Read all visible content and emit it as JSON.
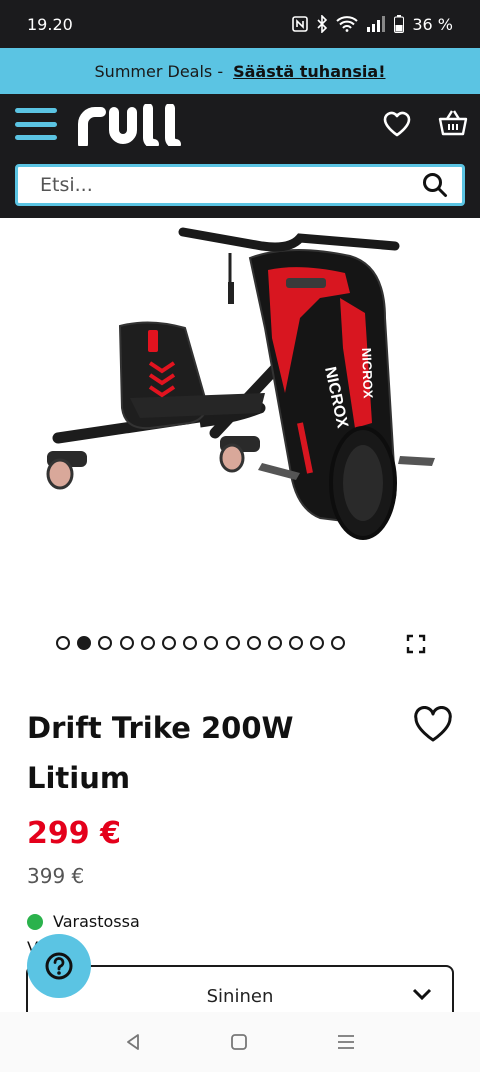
{
  "status_bar": {
    "time": "19.20",
    "battery": "36 %",
    "icons": [
      "nfc-icon",
      "bluetooth-icon",
      "wifi-icon",
      "signal-icon",
      "battery-icon"
    ]
  },
  "promo": {
    "text": "Summer Deals -",
    "link": "Säästä tuhansia!"
  },
  "header": {
    "logo": "rull",
    "search_placeholder": "Etsi..."
  },
  "carousel": {
    "total": 14,
    "active": 2
  },
  "product": {
    "title": "Drift Trike 200W Litium",
    "price": "299 €",
    "old_price": "399 €",
    "stock": "Varastossa",
    "variant_label": "V",
    "variant": "Sininen",
    "brand_text": "NICROX"
  },
  "colors": {
    "accent": "#5bc4e3",
    "dark": "#1b1b1d",
    "price_red": "#e4001b",
    "stock_green": "#2bb24c"
  }
}
